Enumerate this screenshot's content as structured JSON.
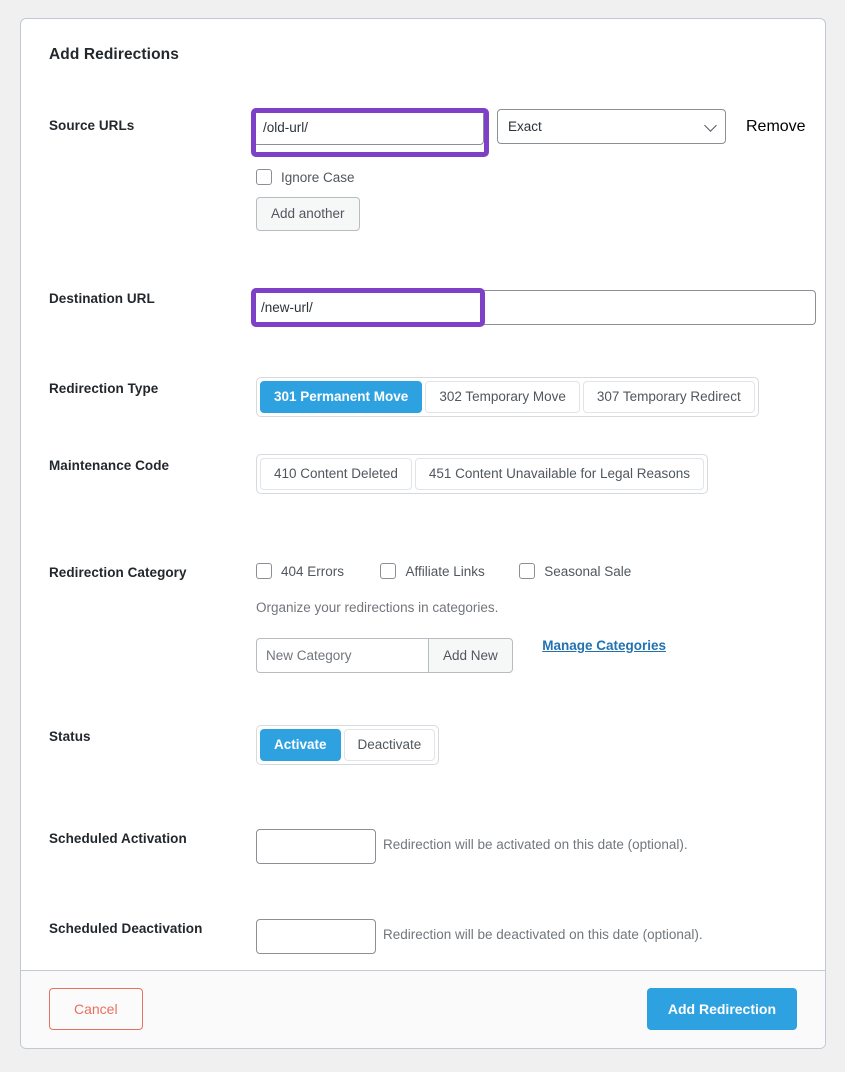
{
  "card": {
    "title": "Add Redirections"
  },
  "source": {
    "label": "Source URLs",
    "url_value": "/old-url/",
    "url_placeholder": "",
    "match_selected": "Exact",
    "remove_label": "Remove",
    "ignore_case_label": "Ignore Case",
    "add_another_label": "Add another"
  },
  "destination": {
    "label": "Destination URL",
    "value": "/new-url/",
    "placeholder": ""
  },
  "redirection_type": {
    "label": "Redirection Type",
    "options": [
      {
        "label": "301 Permanent Move",
        "active": true
      },
      {
        "label": "302 Temporary Move",
        "active": false
      },
      {
        "label": "307 Temporary Redirect",
        "active": false
      }
    ]
  },
  "maintenance_code": {
    "label": "Maintenance Code",
    "options": [
      {
        "label": "410 Content Deleted",
        "active": false
      },
      {
        "label": "451 Content Unavailable for Legal Reasons",
        "active": false
      }
    ]
  },
  "category": {
    "label": "Redirection Category",
    "checkboxes": [
      {
        "label": "404 Errors",
        "checked": false
      },
      {
        "label": "Affiliate Links",
        "checked": false
      },
      {
        "label": "Seasonal Sale",
        "checked": false
      }
    ],
    "help": "Organize your redirections in categories.",
    "new_category_placeholder": "New Category",
    "new_category_value": "",
    "add_new_label": "Add New",
    "manage_link": "Manage Categories"
  },
  "status": {
    "label": "Status",
    "options": [
      {
        "label": "Activate",
        "active": true
      },
      {
        "label": "Deactivate",
        "active": false
      }
    ]
  },
  "scheduled_activation": {
    "label": "Scheduled Activation",
    "value": "",
    "placeholder": "",
    "help": "Redirection will be activated on this date (optional)."
  },
  "scheduled_deactivation": {
    "label": "Scheduled Deactivation",
    "value": "",
    "placeholder": "",
    "help": "Redirection will be deactivated on this date (optional)."
  },
  "footer": {
    "cancel_label": "Cancel",
    "submit_label": "Add Redirection"
  },
  "colors": {
    "accent_blue": "#2ea2e0",
    "highlight_purple": "#7e40c6",
    "danger_red": "#d63638",
    "cancel_red": "#e8705f",
    "link_blue": "#2271b1"
  }
}
